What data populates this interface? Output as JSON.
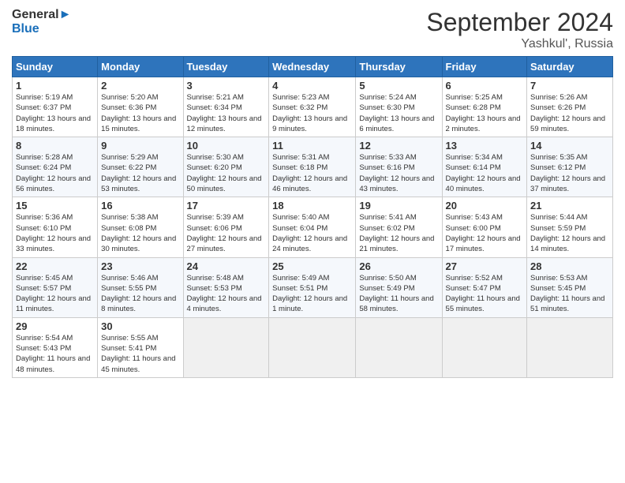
{
  "logo": {
    "line1": "General",
    "line2": "Blue"
  },
  "title": "September 2024",
  "location": "Yashkul', Russia",
  "weekdays": [
    "Sunday",
    "Monday",
    "Tuesday",
    "Wednesday",
    "Thursday",
    "Friday",
    "Saturday"
  ],
  "weeks": [
    [
      {
        "day": "1",
        "sunrise": "Sunrise: 5:19 AM",
        "sunset": "Sunset: 6:37 PM",
        "daylight": "Daylight: 13 hours and 18 minutes."
      },
      {
        "day": "2",
        "sunrise": "Sunrise: 5:20 AM",
        "sunset": "Sunset: 6:36 PM",
        "daylight": "Daylight: 13 hours and 15 minutes."
      },
      {
        "day": "3",
        "sunrise": "Sunrise: 5:21 AM",
        "sunset": "Sunset: 6:34 PM",
        "daylight": "Daylight: 13 hours and 12 minutes."
      },
      {
        "day": "4",
        "sunrise": "Sunrise: 5:23 AM",
        "sunset": "Sunset: 6:32 PM",
        "daylight": "Daylight: 13 hours and 9 minutes."
      },
      {
        "day": "5",
        "sunrise": "Sunrise: 5:24 AM",
        "sunset": "Sunset: 6:30 PM",
        "daylight": "Daylight: 13 hours and 6 minutes."
      },
      {
        "day": "6",
        "sunrise": "Sunrise: 5:25 AM",
        "sunset": "Sunset: 6:28 PM",
        "daylight": "Daylight: 13 hours and 2 minutes."
      },
      {
        "day": "7",
        "sunrise": "Sunrise: 5:26 AM",
        "sunset": "Sunset: 6:26 PM",
        "daylight": "Daylight: 12 hours and 59 minutes."
      }
    ],
    [
      {
        "day": "8",
        "sunrise": "Sunrise: 5:28 AM",
        "sunset": "Sunset: 6:24 PM",
        "daylight": "Daylight: 12 hours and 56 minutes."
      },
      {
        "day": "9",
        "sunrise": "Sunrise: 5:29 AM",
        "sunset": "Sunset: 6:22 PM",
        "daylight": "Daylight: 12 hours and 53 minutes."
      },
      {
        "day": "10",
        "sunrise": "Sunrise: 5:30 AM",
        "sunset": "Sunset: 6:20 PM",
        "daylight": "Daylight: 12 hours and 50 minutes."
      },
      {
        "day": "11",
        "sunrise": "Sunrise: 5:31 AM",
        "sunset": "Sunset: 6:18 PM",
        "daylight": "Daylight: 12 hours and 46 minutes."
      },
      {
        "day": "12",
        "sunrise": "Sunrise: 5:33 AM",
        "sunset": "Sunset: 6:16 PM",
        "daylight": "Daylight: 12 hours and 43 minutes."
      },
      {
        "day": "13",
        "sunrise": "Sunrise: 5:34 AM",
        "sunset": "Sunset: 6:14 PM",
        "daylight": "Daylight: 12 hours and 40 minutes."
      },
      {
        "day": "14",
        "sunrise": "Sunrise: 5:35 AM",
        "sunset": "Sunset: 6:12 PM",
        "daylight": "Daylight: 12 hours and 37 minutes."
      }
    ],
    [
      {
        "day": "15",
        "sunrise": "Sunrise: 5:36 AM",
        "sunset": "Sunset: 6:10 PM",
        "daylight": "Daylight: 12 hours and 33 minutes."
      },
      {
        "day": "16",
        "sunrise": "Sunrise: 5:38 AM",
        "sunset": "Sunset: 6:08 PM",
        "daylight": "Daylight: 12 hours and 30 minutes."
      },
      {
        "day": "17",
        "sunrise": "Sunrise: 5:39 AM",
        "sunset": "Sunset: 6:06 PM",
        "daylight": "Daylight: 12 hours and 27 minutes."
      },
      {
        "day": "18",
        "sunrise": "Sunrise: 5:40 AM",
        "sunset": "Sunset: 6:04 PM",
        "daylight": "Daylight: 12 hours and 24 minutes."
      },
      {
        "day": "19",
        "sunrise": "Sunrise: 5:41 AM",
        "sunset": "Sunset: 6:02 PM",
        "daylight": "Daylight: 12 hours and 21 minutes."
      },
      {
        "day": "20",
        "sunrise": "Sunrise: 5:43 AM",
        "sunset": "Sunset: 6:00 PM",
        "daylight": "Daylight: 12 hours and 17 minutes."
      },
      {
        "day": "21",
        "sunrise": "Sunrise: 5:44 AM",
        "sunset": "Sunset: 5:59 PM",
        "daylight": "Daylight: 12 hours and 14 minutes."
      }
    ],
    [
      {
        "day": "22",
        "sunrise": "Sunrise: 5:45 AM",
        "sunset": "Sunset: 5:57 PM",
        "daylight": "Daylight: 12 hours and 11 minutes."
      },
      {
        "day": "23",
        "sunrise": "Sunrise: 5:46 AM",
        "sunset": "Sunset: 5:55 PM",
        "daylight": "Daylight: 12 hours and 8 minutes."
      },
      {
        "day": "24",
        "sunrise": "Sunrise: 5:48 AM",
        "sunset": "Sunset: 5:53 PM",
        "daylight": "Daylight: 12 hours and 4 minutes."
      },
      {
        "day": "25",
        "sunrise": "Sunrise: 5:49 AM",
        "sunset": "Sunset: 5:51 PM",
        "daylight": "Daylight: 12 hours and 1 minute."
      },
      {
        "day": "26",
        "sunrise": "Sunrise: 5:50 AM",
        "sunset": "Sunset: 5:49 PM",
        "daylight": "Daylight: 11 hours and 58 minutes."
      },
      {
        "day": "27",
        "sunrise": "Sunrise: 5:52 AM",
        "sunset": "Sunset: 5:47 PM",
        "daylight": "Daylight: 11 hours and 55 minutes."
      },
      {
        "day": "28",
        "sunrise": "Sunrise: 5:53 AM",
        "sunset": "Sunset: 5:45 PM",
        "daylight": "Daylight: 11 hours and 51 minutes."
      }
    ],
    [
      {
        "day": "29",
        "sunrise": "Sunrise: 5:54 AM",
        "sunset": "Sunset: 5:43 PM",
        "daylight": "Daylight: 11 hours and 48 minutes."
      },
      {
        "day": "30",
        "sunrise": "Sunrise: 5:55 AM",
        "sunset": "Sunset: 5:41 PM",
        "daylight": "Daylight: 11 hours and 45 minutes."
      },
      null,
      null,
      null,
      null,
      null
    ]
  ]
}
